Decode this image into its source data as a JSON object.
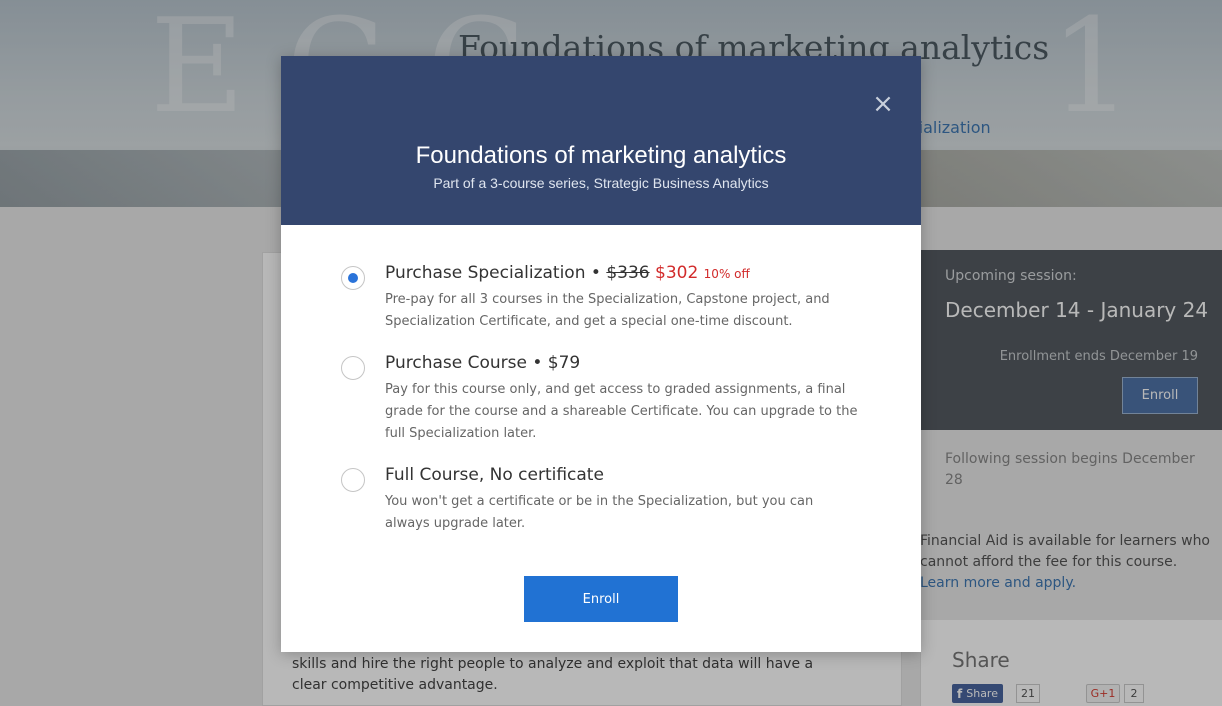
{
  "background": {
    "hero_title": "Foundations of marketing analytics",
    "hero_link_partial": "ecialization",
    "content_text": "skills and hire the right people to analyze and exploit that data will have a clear competitive advantage.",
    "session": {
      "label": "Upcoming session:",
      "dates": "December 14 - January 24",
      "enrollment_ends": "Enrollment ends December 19",
      "enroll_label": "Enroll"
    },
    "following_session": "Following session begins December 28",
    "financial_aid": {
      "text": "Financial Aid is available for learners who cannot afford the fee for this course.",
      "link": "Learn more and apply."
    },
    "share": {
      "title": "Share",
      "facebook_label": "Share",
      "facebook_count": "21",
      "gplus_label": "G+1",
      "gplus_count": "2"
    }
  },
  "modal": {
    "title": "Foundations of marketing analytics",
    "subtitle": "Part of a 3-course series, Strategic Business Analytics",
    "close_icon": "close-icon",
    "options": [
      {
        "title": "Purchase Specialization",
        "separator": " • ",
        "old_price": "$336",
        "price": "$302",
        "discount": "10% off",
        "description": "Pre-pay for all 3 courses in the Specialization, Capstone project, and Specialization Certificate, and get a special one-time discount.",
        "selected": true
      },
      {
        "title": "Purchase Course",
        "separator": " • ",
        "price": "$79",
        "description": "Pay for this course only, and get access to graded assignments, a final grade for the course and a shareable Certificate. You can upgrade to the full Specialization later.",
        "selected": false
      },
      {
        "title": "Full Course, No certificate",
        "description": "You won't get a certificate or be in the Specialization, but you can always upgrade later.",
        "selected": false
      }
    ],
    "enroll_label": "Enroll"
  },
  "colors": {
    "modal_header": "#34466e",
    "accent_blue": "#2172d3",
    "sale_red": "#d22b2b"
  }
}
